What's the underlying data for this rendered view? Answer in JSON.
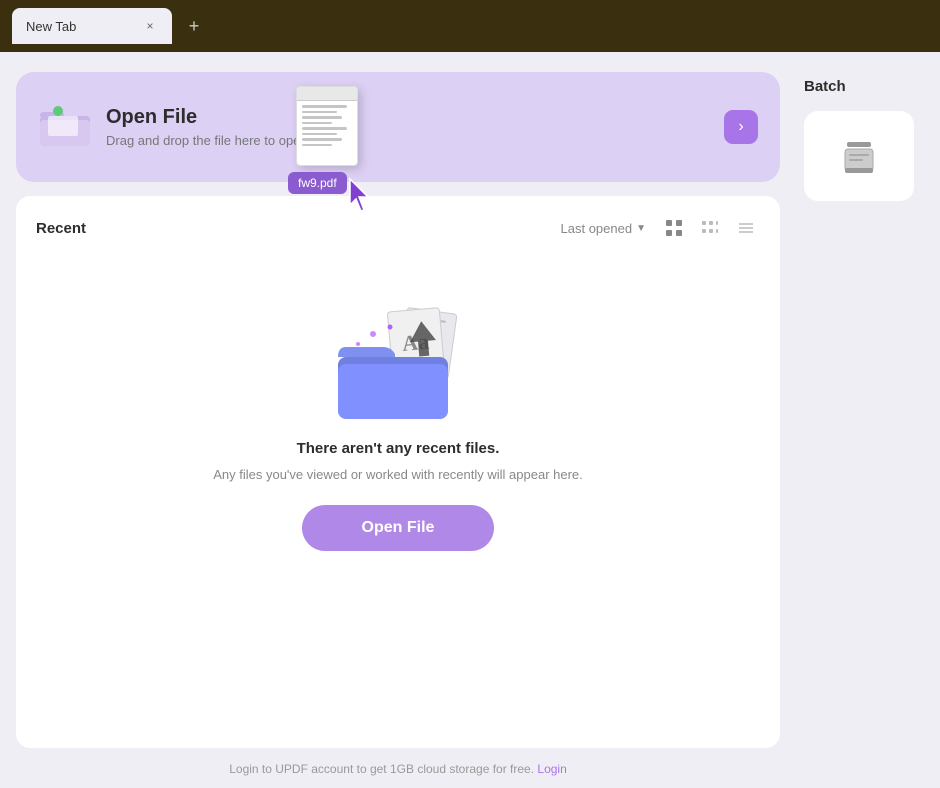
{
  "tabBar": {
    "tab_label": "New Tab",
    "close_icon": "×",
    "add_icon": "+"
  },
  "openFileCard": {
    "title": "Open File",
    "subtitle": "Drag and drop the file here to open",
    "arrow_icon": "›",
    "drag_filename": "fw9.pdf"
  },
  "recent": {
    "title": "Recent",
    "filter_label": "Last opened",
    "filter_arrow": "▼",
    "empty_title": "There aren't any recent files.",
    "empty_subtitle": "Any files you've viewed or worked with recently will appear here.",
    "open_button_label": "Open File"
  },
  "footer": {
    "text": "Login to UPDF account to get 1GB cloud storage for free.",
    "link_text": "Login"
  },
  "sidebar": {
    "batch_label": "Batch",
    "batch_icon": "stack"
  }
}
